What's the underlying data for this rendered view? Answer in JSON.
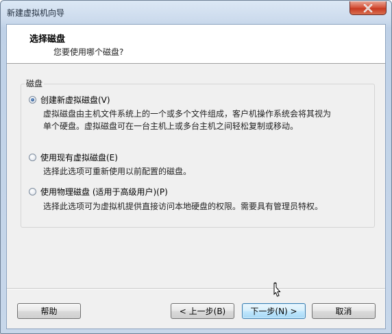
{
  "window": {
    "title": "新建虚拟机向导"
  },
  "header": {
    "title": "选择磁盘",
    "subtitle": "您要使用哪个磁盘?"
  },
  "disk_group": {
    "label": "磁盘",
    "options": [
      {
        "label": "创建新虚拟磁盘(V)",
        "selected": true,
        "description_lines": [
          "虚拟磁盘由主机文件系统上的一个或多个文件组成，客户机操作系统会将其视为",
          "单个硬盘。虚拟磁盘可在一台主机上或多台主机之间轻松复制或移动。"
        ]
      },
      {
        "label": "使用现有虚拟磁盘(E)",
        "selected": false,
        "description_lines": [
          "选择此选项可重新使用以前配置的磁盘。"
        ]
      },
      {
        "label": "使用物理磁盘 (适用于高级用户)(P)",
        "selected": false,
        "description_lines": [
          "选择此选项可为虚拟机提供直接访问本地硬盘的权限。需要具有管理员特权。"
        ]
      }
    ]
  },
  "buttons": {
    "help": "帮助",
    "back": "< 上一步(B)",
    "next": "下一步(N) >",
    "cancel": "取消"
  },
  "colors": {
    "title_bar": "#c7d7ea",
    "close_button": "#c73a22",
    "dialog_background": "#f0f0f0",
    "header_background": "#ffffff",
    "default_button_border": "#3c7fb1"
  },
  "icons": {
    "close": "close-icon",
    "cursor": "mouse-pointer-icon"
  }
}
